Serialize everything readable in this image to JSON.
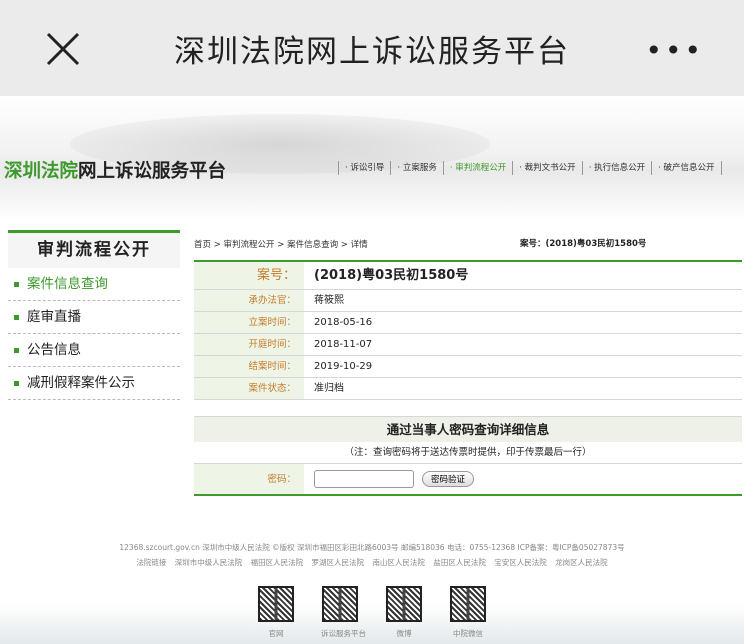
{
  "app_bar": {
    "title": "深圳法院网上诉讼服务平台",
    "more": "•••"
  },
  "site": {
    "logo_green": "深圳法院",
    "logo_black": "网上诉讼服务平台",
    "nav": [
      "诉讼引导",
      "立案服务",
      "审判流程公开",
      "裁判文书公开",
      "执行信息公开",
      "破产信息公开"
    ],
    "active_nav": "审判流程公开",
    "accent": "#3e9a2c"
  },
  "sidebar": {
    "title": "审判流程公开",
    "items": [
      "案件信息查询",
      "庭审直播",
      "公告信息",
      "减刑假释案件公示"
    ]
  },
  "breadcrumb": [
    "首页",
    "审判流程公开",
    "案件信息查询",
    "详情"
  ],
  "case_no_top": "案号：(2018)粤03民初1580号",
  "details": [
    {
      "label": "案号：",
      "value": "(2018)粤03民初1580号"
    },
    {
      "label": "承办法官：",
      "value": "蒋筱熙"
    },
    {
      "label": "立案时间：",
      "value": "2018-05-16"
    },
    {
      "label": "开庭时间：",
      "value": "2018-11-07"
    },
    {
      "label": "结案时间：",
      "value": "2019-10-29"
    },
    {
      "label": "案件状态：",
      "value": "准归档"
    }
  ],
  "password": {
    "heading": "通过当事人密码查询详细信息",
    "note": "（注：查询密码将于送达传票时提供，印于传票最后一行）",
    "label": "密码：",
    "value": "",
    "button": "密码验证"
  },
  "footer": {
    "line1": "12368.szcourt.gov.cn 深圳市中级人民法院 ©版权 深圳市福田区彩田北路6003号 邮编518036 电话：0755-12368 ICP备案：粤ICP备05027873号",
    "links_label": "法院链接",
    "links": [
      "深圳市中级人民法院",
      "福田区人民法院",
      "罗湖区人民法院",
      "南山区人民法院",
      "盐田区人民法院",
      "宝安区人民法院",
      "龙岗区人民法院"
    ],
    "qr_captions": [
      "官网",
      "诉讼服务平台",
      "微博",
      "中院微信"
    ]
  }
}
